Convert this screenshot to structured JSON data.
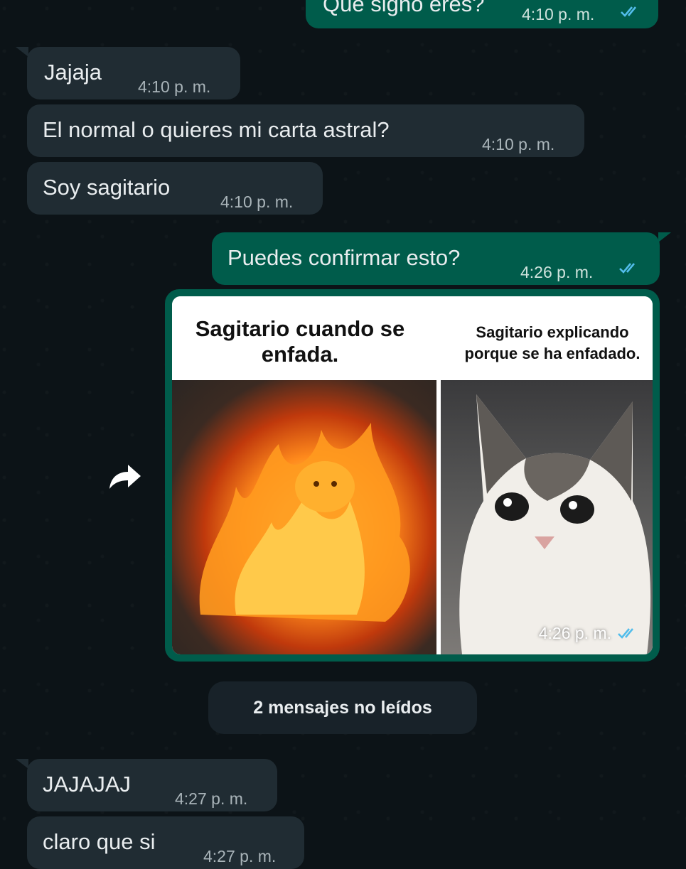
{
  "messages": [
    {
      "id": "m0",
      "side": "out",
      "text": "Qué signo eres?",
      "time": "4:10 p. m."
    },
    {
      "id": "m1",
      "side": "in",
      "text": "Jajaja",
      "time": "4:10 p. m."
    },
    {
      "id": "m2",
      "side": "in",
      "text": "El normal o quieres mi carta astral?",
      "time": "4:10 p. m."
    },
    {
      "id": "m3",
      "side": "in",
      "text": "Soy sagitario",
      "time": "4:10 p. m."
    },
    {
      "id": "m4",
      "side": "out",
      "text": "Puedes confirmar esto?",
      "time": "4:26 p. m."
    },
    {
      "id": "m6",
      "side": "in",
      "text": "JAJAJAJ",
      "time": "4:27 p. m."
    },
    {
      "id": "m7",
      "side": "in",
      "text": "claro que si",
      "time": "4:27 p. m."
    }
  ],
  "media_message": {
    "caption_left": "Sagitario cuando se enfada.",
    "caption_right": "Sagitario explicando porque se ha enfadado.",
    "time": "4:26 p. m."
  },
  "unread_divider": "2 mensajes no leídos",
  "colors": {
    "background": "#0c1317",
    "incoming_bubble": "#202c33",
    "outgoing_bubble": "#005c4b",
    "read_ticks": "#53bdeb"
  },
  "icons": {
    "read_receipt": "double-check-icon",
    "forward": "forward-arrow-icon"
  }
}
